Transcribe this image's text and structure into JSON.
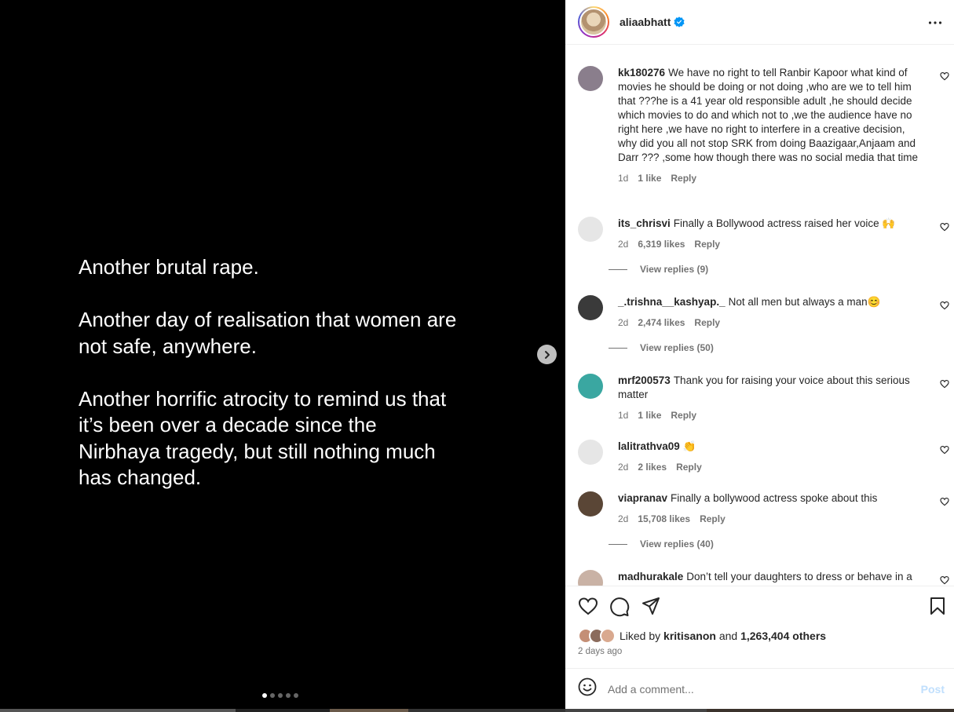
{
  "post": {
    "paragraphs": [
      "Another brutal rape.",
      "Another day of realisation that women are\nnot safe, anywhere.",
      "Another horrific atrocity to remind us that\nit’s been over a decade since the\nNirbhaya tragedy, but still nothing much\nhas changed."
    ],
    "carousel_total": 5,
    "carousel_active": 1
  },
  "header": {
    "username": "aliaabhatt",
    "verified": true
  },
  "comments": [
    {
      "user": "kk180276",
      "text": "We have no right to tell Ranbir Kapoor what kind of movies he should be doing or not doing ,who are we to tell him that ???he is a 41 year old responsible adult ,he should decide which movies to do and which not to ,we the audience have no right here ,we have no right to interfere in a creative decision, why did you all not stop SRK from doing Baazigaar,Anjaam and Darr ??? ,some how though there was no social media that time",
      "age": "1d",
      "likes": "1 like",
      "reply": "Reply",
      "avatar_color": "#8a7e8c"
    },
    {
      "user": "its_chrisvi",
      "text": "Finally a Bollywood actress raised her voice 🙌",
      "age": "2d",
      "likes": "6,319 likes",
      "reply": "Reply",
      "view_replies": "View replies (9)",
      "avatar_color": "#e6e6e6"
    },
    {
      "user": "_.trishna__kashyap._",
      "text": "Not all men but always a man😊",
      "age": "2d",
      "likes": "2,474 likes",
      "reply": "Reply",
      "view_replies": "View replies (50)",
      "avatar_color": "#3a3a3a"
    },
    {
      "user": "mrf200573",
      "text": "Thank you for raising your voice about this serious matter",
      "age": "1d",
      "likes": "1 like",
      "reply": "Reply",
      "avatar_color": "#3aa7a1"
    },
    {
      "user": "lalitrathva09",
      "text": "👏",
      "age": "2d",
      "likes": "2 likes",
      "reply": "Reply",
      "avatar_color": "#e6e6e6"
    },
    {
      "user": "viapranav",
      "text": "Finally a bollywood actress spoke about this",
      "age": "2d",
      "likes": "15,708 likes",
      "reply": "Reply",
      "view_replies": "View replies (40)",
      "avatar_color": "#5a4636"
    },
    {
      "user": "madhurakale",
      "text": "Don’t tell your daughters to dress or behave in a",
      "avatar_color": "#c9b2a5"
    }
  ],
  "likes": {
    "prefix": "Liked by",
    "user": "kritisanon",
    "joiner": "and",
    "others": "1,263,404 others"
  },
  "time_ago": "2 days ago",
  "comment_box": {
    "placeholder": "Add a comment...",
    "post_label": "Post"
  },
  "colors": {
    "verified": "#0095f6",
    "post_disabled": "#c0dffd"
  }
}
